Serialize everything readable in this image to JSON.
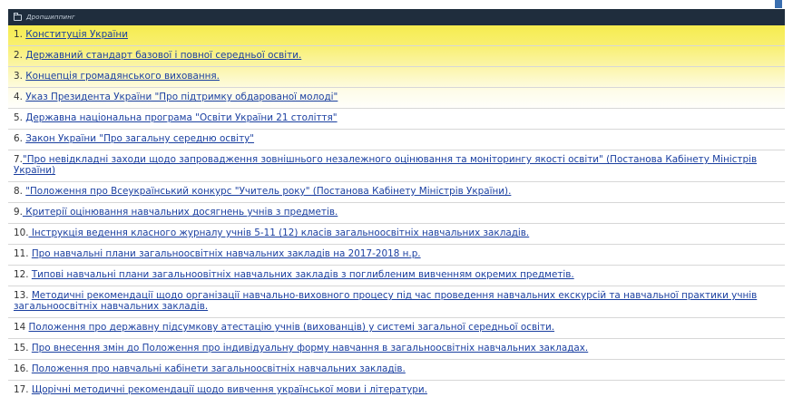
{
  "header": {
    "title": "Дропшиппинг",
    "icon": "folder-icon"
  },
  "items": [
    {
      "num": "1. ",
      "text": "Конституція України",
      "lines": 1
    },
    {
      "num": "2. ",
      "text": "Державний стандарт базової і повної середньої освіти.",
      "lines": 1
    },
    {
      "num": "3. ",
      "text": "Концепція громадянського виховання.",
      "lines": 1
    },
    {
      "num": "4. ",
      "text": "Указ Президента України \"Про підтримку обдарованої молоді\"",
      "lines": 1
    },
    {
      "num": "5. ",
      "text": "Державна національна програма \"Освіти України 21 століття\"",
      "lines": 1
    },
    {
      "num": "6. ",
      "text": "Закон України \"Про загальну середню освіту\"",
      "lines": 1
    },
    {
      "num": "7.",
      "text": "\"Про невідкладні заходи щодо запровадження зовнішнього незалежного оцінювання та моніторингу якості освіти\" (Постанова Кабінету Міністрів України)",
      "lines": 2
    },
    {
      "num": "8. ",
      "text": "\"Положення про Всеукраїнський конкурс \"Учитель року\" (Постанова Кабінету Міністрів України).",
      "lines": 1
    },
    {
      "num": "9.",
      "text": " Критерії оцінювання навчальних досягнень учнів з предметів.",
      "lines": 1
    },
    {
      "num": "10.",
      "text": " Інструкція ведення класного журналу учнів 5-11 (12)  класів загальноосвітніх навчальних закладів.",
      "lines": 1
    },
    {
      "num": "11. ",
      "text": "Про навчальні плани загальноосвітніх навчальних закладів на 2017-2018 н.р.",
      "lines": 1
    },
    {
      "num": "12. ",
      "text": "Типові навчальні плани загальноовітніх навчальних закладів з поглибленим вивченням  окремих предметів.",
      "lines": 1
    },
    {
      "num": "13. ",
      "text": "Методичні рекомендації щодо організації навчально-виховного процесу під час проведення навчальних екскурсій та навчальної практики учнів загальноосвітніх навчальних закладів.",
      "lines": 2
    },
    {
      "num": "14 ",
      "text": "Положення про державну підсумкову атестацію учнів (вихованців) у системі загальної середньої освіти.",
      "lines": 1
    },
    {
      "num": "15. ",
      "text": "Про внесення змін до Положення про індивідуальну форму навчання в загальноосвітніх навчальних закладах.",
      "lines": 1
    },
    {
      "num": "16. ",
      "text": "Положення про навчальні кабінети загальноосвітніх навчальних закладів.",
      "lines": 1
    },
    {
      "num": "17. ",
      "text": "Щорічні методичні рекомендації щодо вивчення української мови і літератури.",
      "lines": 1
    }
  ]
}
